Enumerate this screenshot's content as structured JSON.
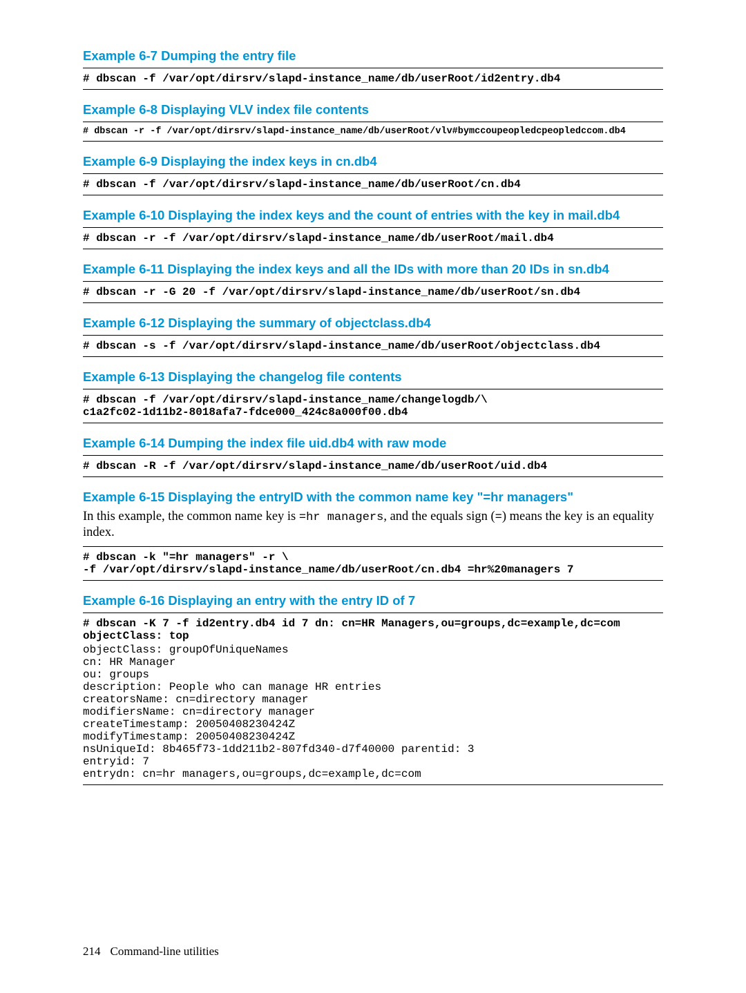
{
  "examples": [
    {
      "title": "Example 6-7 Dumping the entry file",
      "code": "# dbscan -f /var/opt/dirsrv/slapd-instance_name/db/userRoot/id2entry.db4"
    },
    {
      "title": "Example 6-8 Displaying VLV index file contents",
      "code_small": "# dbscan -r -f /var/opt/dirsrv/slapd-instance_name/db/userRoot/vlv#bymccoupeopledcpeopledccom.db4"
    },
    {
      "title": "Example 6-9 Displaying the index keys in cn.db4",
      "code": "# dbscan -f /var/opt/dirsrv/slapd-instance_name/db/userRoot/cn.db4"
    },
    {
      "title": "Example 6-10 Displaying the index keys and the count of entries with the key in mail.db4",
      "code": "# dbscan -r -f /var/opt/dirsrv/slapd-instance_name/db/userRoot/mail.db4"
    },
    {
      "title": "Example 6-11 Displaying the index keys and all the IDs with more than 20 IDs in sn.db4",
      "code": "# dbscan -r -G 20 -f /var/opt/dirsrv/slapd-instance_name/db/userRoot/sn.db4"
    },
    {
      "title": "Example 6-12 Displaying the summary of objectclass.db4",
      "code": "# dbscan -s -f /var/opt/dirsrv/slapd-instance_name/db/userRoot/objectclass.db4"
    },
    {
      "title": "Example 6-13 Displaying the changelog file contents",
      "code": "# dbscan -f /var/opt/dirsrv/slapd-instance_name/changelogdb/\\\nc1a2fc02-1d11b2-8018afa7-fdce000_424c8a000f00.db4"
    },
    {
      "title": "Example 6-14 Dumping the index file uid.db4 with raw mode",
      "code": "# dbscan -R -f /var/opt/dirsrv/slapd-instance_name/db/userRoot/uid.db4"
    },
    {
      "title": "Example 6-15 Displaying the entryID with the common name key \"=hr managers\"",
      "body": {
        "prefix": "In this example, the common name key is ",
        "inline_code1": "=hr managers",
        "mid": ", and the equals sign (",
        "inline_code2": "=",
        "suffix": ") means the key is an equality index."
      },
      "code": "# dbscan -k \"=hr managers\" -r \\\n-f /var/opt/dirsrv/slapd-instance_name/db/userRoot/cn.db4 =hr%20managers 7"
    },
    {
      "title": "Example 6-16 Displaying an entry with the entry ID of 7",
      "code": "# dbscan -K 7 -f id2entry.db4 id 7 dn: cn=HR Managers,ou=groups,dc=example,dc=com\nobjectClass: top",
      "output": "objectClass: groupOfUniqueNames\ncn: HR Manager\nou: groups\ndescription: People who can manage HR entries\ncreatorsName: cn=directory manager\nmodifiersName: cn=directory manager\ncreateTimestamp: 20050408230424Z\nmodifyTimestamp: 20050408230424Z\nnsUniqueId: 8b465f73-1dd211b2-807fd340-d7f40000 parentid: 3\nentryid: 7\nentrydn: cn=hr managers,ou=groups,dc=example,dc=com"
    }
  ],
  "footer": {
    "page": "214",
    "section": "Command-line utilities"
  }
}
